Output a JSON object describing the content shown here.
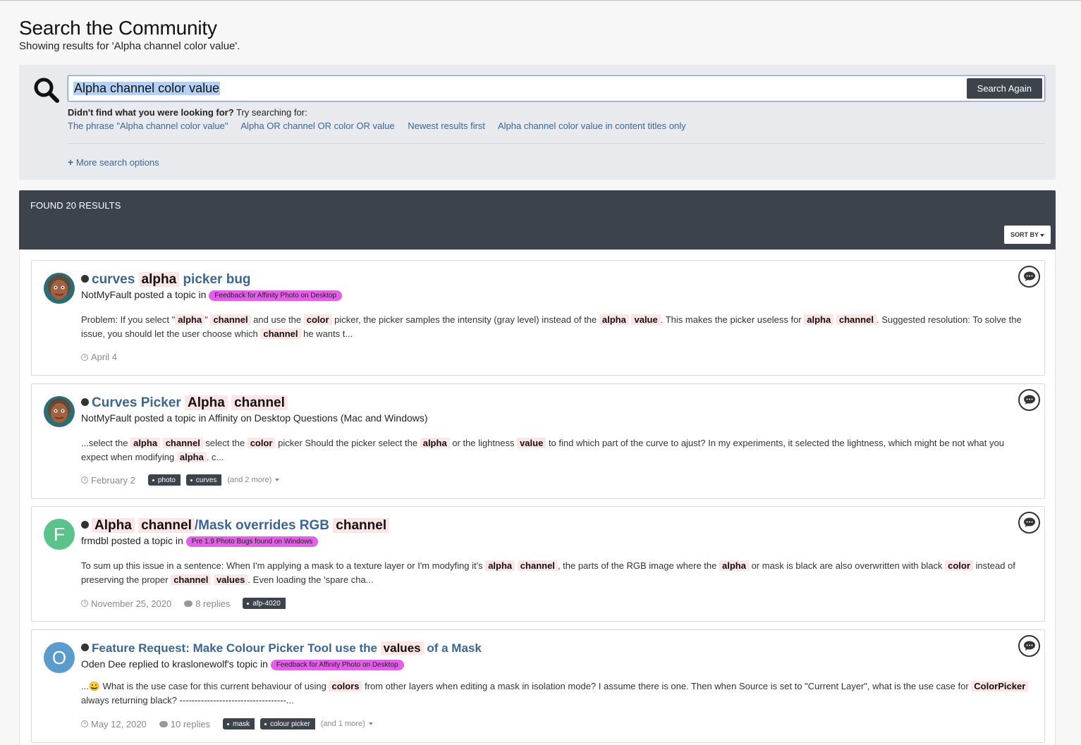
{
  "page": {
    "title": "Search the Community",
    "subtitle": "Showing results for 'Alpha channel color value'."
  },
  "search": {
    "query": "Alpha channel color value",
    "button_label": "Search Again",
    "suggest_intro_bold": "Didn't find what you were looking for?",
    "suggest_intro_rest": " Try searching for:",
    "suggestions": [
      "The phrase \"Alpha channel color value\"",
      "Alpha OR channel OR color OR value",
      "Newest results first",
      "Alpha channel color value in content titles only"
    ],
    "more_options": "More search options"
  },
  "results_header": {
    "count_label": "FOUND 20 RESULTS",
    "sort_label": "SORT BY"
  },
  "results": [
    {
      "author": "NotMyFault",
      "action": " posted a topic in ",
      "forum": "Feedback for Affinity Photo on Desktop",
      "date": "April 4",
      "title_parts": [
        {
          "t": "curves ",
          "h": false
        },
        {
          "t": "alpha",
          "h": true
        },
        {
          "t": " picker bug",
          "h": false
        }
      ],
      "snippet_parts": [
        {
          "t": "Problem: If you select \"",
          "h": false
        },
        {
          "t": "alpha",
          "h": true
        },
        {
          "t": "\" ",
          "h": false
        },
        {
          "t": "channel",
          "h": true
        },
        {
          "t": " and use the ",
          "h": false
        },
        {
          "t": "color",
          "h": true
        },
        {
          "t": " picker, the picker samples the intensity (gray level) instead of the ",
          "h": false
        },
        {
          "t": "alpha",
          "h": true
        },
        {
          "t": " ",
          "h": false
        },
        {
          "t": "value",
          "h": true
        },
        {
          "t": ". This makes the picker useless for ",
          "h": false
        },
        {
          "t": "alpha",
          "h": true
        },
        {
          "t": " ",
          "h": false
        },
        {
          "t": "channel",
          "h": true
        },
        {
          "t": ". Suggested resolution: To solve the issue, you should let the user choose which ",
          "h": false
        },
        {
          "t": "channel",
          "h": true
        },
        {
          "t": " he wants t...",
          "h": false
        }
      ]
    },
    {
      "author": "NotMyFault",
      "action": " posted a topic in ",
      "forum_plain": "Affinity on Desktop Questions (Mac and Windows)",
      "date": "February 2",
      "tags": [
        "photo",
        "curves"
      ],
      "more_tags": "(and 2 more)",
      "title_parts": [
        {
          "t": "Curves Picker ",
          "h": false
        },
        {
          "t": "Alpha",
          "h": true
        },
        {
          "t": " ",
          "h": false
        },
        {
          "t": "channel",
          "h": true
        }
      ],
      "snippet_parts": [
        {
          "t": "...select the ",
          "h": false
        },
        {
          "t": "alpha",
          "h": true
        },
        {
          "t": " ",
          "h": false
        },
        {
          "t": "channel",
          "h": true
        },
        {
          "t": " select the ",
          "h": false
        },
        {
          "t": "color",
          "h": true
        },
        {
          "t": " picker Should the picker select the ",
          "h": false
        },
        {
          "t": "alpha",
          "h": true
        },
        {
          "t": " or the lightness ",
          "h": false
        },
        {
          "t": "value",
          "h": true
        },
        {
          "t": " to find which part of the curve to ajust? In my experiments, it selected the lightness, which might be not what you expect when modifying ",
          "h": false
        },
        {
          "t": "alpha",
          "h": true
        },
        {
          "t": ". c...",
          "h": false
        }
      ]
    },
    {
      "author": "frmdbl",
      "avatar_letter": "F",
      "avatar_color": "#59c389",
      "action": " posted a topic in ",
      "forum": "Pre 1.9 Photo Bugs found on Windows",
      "date": "November 25, 2020",
      "replies": "8 replies",
      "tags": [
        "afp-4020"
      ],
      "title_parts": [
        {
          "t": "Alpha",
          "h": true
        },
        {
          "t": " ",
          "h": false
        },
        {
          "t": "channel",
          "h": true
        },
        {
          "t": "/Mask overrides RGB ",
          "h": false
        },
        {
          "t": "channel",
          "h": true
        }
      ],
      "snippet_parts": [
        {
          "t": "To sum up this issue in a sentence: When I'm applying a mask to a texture layer or I'm modyfing it's ",
          "h": false
        },
        {
          "t": "alpha",
          "h": true
        },
        {
          "t": " ",
          "h": false
        },
        {
          "t": "channel",
          "h": true
        },
        {
          "t": ", the parts of the RGB image where the ",
          "h": false
        },
        {
          "t": "alpha",
          "h": true
        },
        {
          "t": " or mask is black are also overwritten with black ",
          "h": false
        },
        {
          "t": "color",
          "h": true
        },
        {
          "t": " instead of preserving the proper ",
          "h": false
        },
        {
          "t": "channel",
          "h": true
        },
        {
          "t": " ",
          "h": false
        },
        {
          "t": "values",
          "h": true
        },
        {
          "t": ". Even loading the 'spare cha...",
          "h": false
        }
      ]
    },
    {
      "author": "Oden Dee",
      "avatar_letter": "O",
      "avatar_color": "#5a9ccc",
      "action": " replied to kraslonewolf's topic in ",
      "forum": "Feedback for Affinity Photo on Desktop",
      "date": "May 12, 2020",
      "replies": "10 replies",
      "tags": [
        "mask",
        "colour picker"
      ],
      "more_tags": "(and 1 more)",
      "title_parts": [
        {
          "t": "Feature Request: Make Colour Picker Tool use the ",
          "h": false
        },
        {
          "t": "values",
          "h": true
        },
        {
          "t": " of a Mask",
          "h": false
        }
      ],
      "snippet_parts": [
        {
          "t": "...😀 What is the use case for this current behaviour of using ",
          "h": false
        },
        {
          "t": "colors",
          "h": true
        },
        {
          "t": " from other layers when editing a mask in isolation mode? I assume there is one. Then when Source is set to \"Current Layer\", what is the use case for ",
          "h": false
        },
        {
          "t": "ColorPicker",
          "h": true
        },
        {
          "t": " always returning black? -----------------------------------...",
          "h": false
        }
      ]
    }
  ]
}
